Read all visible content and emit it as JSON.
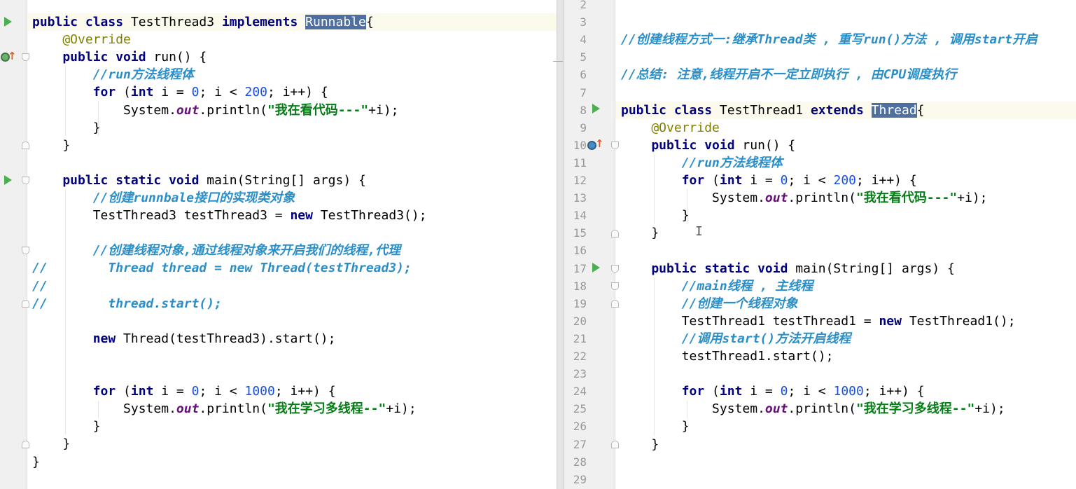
{
  "left_editor": {
    "lines": [
      {
        "id": "l1",
        "parts": [
          [
            "kw",
            "public class "
          ],
          [
            "",
            "TestThread3 "
          ],
          [
            "kw",
            "implements "
          ],
          [
            "hl",
            "Runnable"
          ],
          [
            "",
            "{"
          ]
        ]
      },
      {
        "id": "l2",
        "parts": [
          [
            "ann",
            "    @Override"
          ]
        ]
      },
      {
        "id": "l3",
        "parts": [
          [
            "kw",
            "    public void "
          ],
          [
            "",
            "run() {"
          ]
        ]
      },
      {
        "id": "l4",
        "parts": [
          [
            "cm",
            "        //run方法线程体"
          ]
        ]
      },
      {
        "id": "l5",
        "parts": [
          [
            "kw",
            "        for "
          ],
          [
            "",
            "("
          ],
          [
            "kw",
            "int "
          ],
          [
            "",
            "i = "
          ],
          [
            "num",
            "0"
          ],
          [
            "",
            "; i < "
          ],
          [
            "num",
            "200"
          ],
          [
            "",
            "; i++) {"
          ]
        ]
      },
      {
        "id": "l6",
        "parts": [
          [
            "",
            "            System."
          ],
          [
            "fld",
            "out"
          ],
          [
            "",
            ".println("
          ],
          [
            "str",
            "\"我在看代码---\""
          ],
          [
            "",
            "+i);"
          ]
        ]
      },
      {
        "id": "l7",
        "parts": [
          [
            "",
            "        }"
          ]
        ]
      },
      {
        "id": "l8",
        "parts": [
          [
            "",
            "    }"
          ]
        ]
      },
      {
        "id": "l9",
        "parts": [
          [
            "",
            ""
          ]
        ]
      },
      {
        "id": "l10",
        "parts": [
          [
            "kw",
            "    public static void "
          ],
          [
            "",
            "main(String[] args) {"
          ]
        ]
      },
      {
        "id": "l11",
        "parts": [
          [
            "cm",
            "        //创建runnbale接口的实现类对象"
          ]
        ]
      },
      {
        "id": "l12",
        "parts": [
          [
            "",
            "        TestThread3 testThread3 = "
          ],
          [
            "kw",
            "new "
          ],
          [
            "",
            "TestThread3();"
          ]
        ]
      },
      {
        "id": "l13",
        "parts": [
          [
            "",
            ""
          ]
        ]
      },
      {
        "id": "l14",
        "parts": [
          [
            "cm",
            "        //创建线程对象,通过线程对象来开启我们的线程,代理"
          ]
        ]
      },
      {
        "id": "l15",
        "parts": [
          [
            "cm",
            "//        Thread thread = new Thread(testThread3);"
          ]
        ]
      },
      {
        "id": "l16",
        "parts": [
          [
            "cm",
            "//"
          ]
        ]
      },
      {
        "id": "l17",
        "parts": [
          [
            "cm",
            "//        thread.start();"
          ]
        ]
      },
      {
        "id": "l18",
        "parts": [
          [
            "",
            ""
          ]
        ]
      },
      {
        "id": "l19",
        "parts": [
          [
            "kw",
            "        new "
          ],
          [
            "",
            "Thread(testThread3).start();"
          ]
        ]
      },
      {
        "id": "l20",
        "parts": [
          [
            "",
            ""
          ]
        ]
      },
      {
        "id": "l21",
        "parts": [
          [
            "",
            ""
          ]
        ]
      },
      {
        "id": "l22",
        "parts": [
          [
            "kw",
            "        for "
          ],
          [
            "",
            "("
          ],
          [
            "kw",
            "int "
          ],
          [
            "",
            "i = "
          ],
          [
            "num",
            "0"
          ],
          [
            "",
            "; i < "
          ],
          [
            "num",
            "1000"
          ],
          [
            "",
            "; i++) {"
          ]
        ]
      },
      {
        "id": "l23",
        "parts": [
          [
            "",
            "            System."
          ],
          [
            "fld",
            "out"
          ],
          [
            "",
            ".println("
          ],
          [
            "str",
            "\"我在学习多线程--\""
          ],
          [
            "",
            "+i);"
          ]
        ]
      },
      {
        "id": "l24",
        "parts": [
          [
            "",
            "        }"
          ]
        ]
      },
      {
        "id": "l25",
        "parts": [
          [
            "",
            "    }"
          ]
        ]
      },
      {
        "id": "l26",
        "parts": [
          [
            "",
            "}"
          ]
        ]
      }
    ]
  },
  "right_editor": {
    "lines": [
      {
        "n": "2",
        "parts": [
          [
            "",
            ""
          ]
        ]
      },
      {
        "n": "3",
        "parts": [
          [
            "",
            ""
          ]
        ]
      },
      {
        "n": "4",
        "parts": [
          [
            "cm",
            "//创建线程方式一:继承Thread类 , 重写run()方法 , 调用start开启"
          ]
        ]
      },
      {
        "n": "5",
        "parts": [
          [
            "",
            ""
          ]
        ]
      },
      {
        "n": "6",
        "parts": [
          [
            "cm",
            "//总结: 注意,线程开启不一定立即执行 , 由CPU调度执行"
          ]
        ]
      },
      {
        "n": "7",
        "parts": [
          [
            "",
            ""
          ]
        ]
      },
      {
        "n": "8",
        "parts": [
          [
            "kw",
            "public class "
          ],
          [
            "",
            "TestThread1 "
          ],
          [
            "kw",
            "extends "
          ],
          [
            "hl",
            "Thread"
          ],
          [
            "",
            "{"
          ]
        ]
      },
      {
        "n": "9",
        "parts": [
          [
            "ann",
            "    @Override"
          ]
        ]
      },
      {
        "n": "10",
        "parts": [
          [
            "kw",
            "    public void "
          ],
          [
            "",
            "run() {"
          ]
        ]
      },
      {
        "n": "11",
        "parts": [
          [
            "cm",
            "        //run方法线程体"
          ]
        ]
      },
      {
        "n": "12",
        "parts": [
          [
            "kw",
            "        for "
          ],
          [
            "",
            "("
          ],
          [
            "kw",
            "int "
          ],
          [
            "",
            "i = "
          ],
          [
            "num",
            "0"
          ],
          [
            "",
            "; i < "
          ],
          [
            "num",
            "200"
          ],
          [
            "",
            "; i++) {"
          ]
        ]
      },
      {
        "n": "13",
        "parts": [
          [
            "",
            "            System."
          ],
          [
            "fld",
            "out"
          ],
          [
            "",
            ".println("
          ],
          [
            "str",
            "\"我在看代码---\""
          ],
          [
            "",
            "+i);"
          ]
        ]
      },
      {
        "n": "14",
        "parts": [
          [
            "",
            "        }"
          ]
        ]
      },
      {
        "n": "15",
        "parts": [
          [
            "",
            "    }"
          ]
        ]
      },
      {
        "n": "16",
        "parts": [
          [
            "",
            ""
          ]
        ]
      },
      {
        "n": "17",
        "parts": [
          [
            "kw",
            "    public static void "
          ],
          [
            "",
            "main(String[] args) {"
          ]
        ]
      },
      {
        "n": "18",
        "parts": [
          [
            "cm",
            "        //main线程 , 主线程"
          ]
        ]
      },
      {
        "n": "19",
        "parts": [
          [
            "cm",
            "        //创建一个线程对象"
          ]
        ]
      },
      {
        "n": "20",
        "parts": [
          [
            "",
            "        TestThread1 testThread1 = "
          ],
          [
            "kw",
            "new "
          ],
          [
            "",
            "TestThread1();"
          ]
        ]
      },
      {
        "n": "21",
        "parts": [
          [
            "cm",
            "        //调用start()方法开启线程"
          ]
        ]
      },
      {
        "n": "22",
        "parts": [
          [
            "",
            "        testThread1.start();"
          ]
        ]
      },
      {
        "n": "23",
        "parts": [
          [
            "",
            ""
          ]
        ]
      },
      {
        "n": "24",
        "parts": [
          [
            "kw",
            "        for "
          ],
          [
            "",
            "("
          ],
          [
            "kw",
            "int "
          ],
          [
            "",
            "i = "
          ],
          [
            "num",
            "0"
          ],
          [
            "",
            "; i < "
          ],
          [
            "num",
            "1000"
          ],
          [
            "",
            "; i++) {"
          ]
        ]
      },
      {
        "n": "25",
        "parts": [
          [
            "",
            "            System."
          ],
          [
            "fld",
            "out"
          ],
          [
            "",
            ".println("
          ],
          [
            "str",
            "\"我在学习多线程--\""
          ],
          [
            "",
            "+i);"
          ]
        ]
      },
      {
        "n": "26",
        "parts": [
          [
            "",
            "        }"
          ]
        ]
      },
      {
        "n": "27",
        "parts": [
          [
            "",
            "    }"
          ]
        ]
      },
      {
        "n": "28",
        "parts": [
          [
            "",
            ""
          ]
        ]
      },
      {
        "n": "29",
        "parts": [
          [
            "",
            ""
          ]
        ]
      }
    ]
  },
  "colors": {
    "keyword": "#000080",
    "comment": "#2a8fc9",
    "string": "#067d17",
    "number": "#1750eb",
    "annotation": "#808000",
    "static_field": "#660e7a",
    "selection": "#4f6fa0",
    "run_icon": "#4caf50"
  },
  "icons": {
    "run": "run-triangle-icon",
    "fold": "fold-marker-icon",
    "override": "override-method-icon",
    "text_cursor": "I-beam"
  },
  "cursor_glyph": "I"
}
